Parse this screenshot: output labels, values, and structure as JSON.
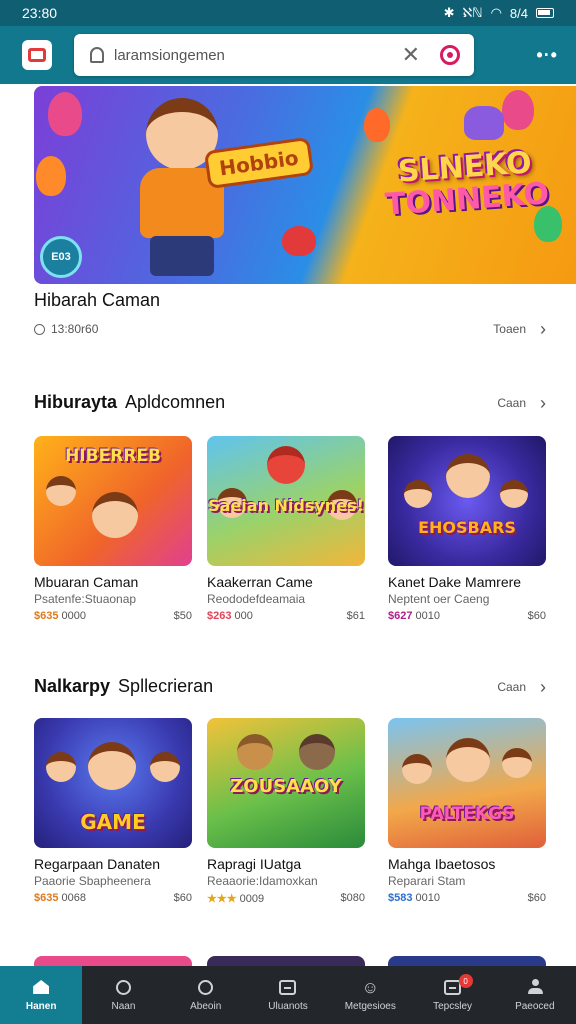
{
  "status_bar": {
    "time": "23:80",
    "icons": [
      "bluetooth-icon",
      "signal-icon",
      "wifi-icon",
      "battery-icon"
    ],
    "signal_text": "ℵℕ",
    "percent": "8/4"
  },
  "top_bar": {
    "search_text": "laramsiongemen",
    "colors": {
      "bar": "#11788d",
      "mic": "#d81b60"
    }
  },
  "hero": {
    "badge_text": "Hobbio",
    "title_line1": "SLNEKO",
    "title_line2": "TONNEKO",
    "chip_text": "E03"
  },
  "featured": {
    "title": "Hibarah Caman",
    "meta": "13:80r60",
    "more_label": "Toaen"
  },
  "section1": {
    "title_bold": "Hiburayta",
    "title_rest": "Apldcomnen",
    "more_label": "Caan",
    "cards": [
      {
        "thumb_text": "HIBERREB",
        "title": "Mbuaran Caman",
        "sub": "Psatenfe:Stuaonap",
        "price": "$635",
        "count": "0000",
        "right": "$50",
        "price_color": "#e07b1c"
      },
      {
        "thumb_text": "Saeian Nidsynes!",
        "title": "Kaakerran Came",
        "sub": "Reododefdeamaia",
        "price": "$263",
        "count": "000",
        "right": "$61",
        "price_color": "#e0445a"
      },
      {
        "thumb_text": "EHOSBARS",
        "title": "Kanet Dake Mamrere",
        "sub": "Neptent oer Caeng",
        "price": "$627",
        "count": "0010",
        "right": "$60",
        "price_color": "#b0208a"
      }
    ]
  },
  "section2": {
    "title_bold": "Nalkarpy",
    "title_rest": "Spllecrieran",
    "more_label": "Caan",
    "cards": [
      {
        "thumb_text": "GAME",
        "title": "Regarpaan Danaten",
        "sub": "Paaorie Sbapheenera",
        "price": "$635",
        "count": "0068",
        "right": "$60",
        "price_color": "#e07b1c"
      },
      {
        "thumb_text": "ZOUSAAOY",
        "title": "Rapragi IUatga",
        "sub": "Reaaorie:Idamoxkan",
        "price": "★★★",
        "count": "0009",
        "right": "$080",
        "price_color": "#e0a81c"
      },
      {
        "thumb_text": "PALTEKGS",
        "title": "Mahga Ibaetosos",
        "sub": "Reparari Stam",
        "price": "$583",
        "count": "0010",
        "right": "$60",
        "price_color": "#2a6fd0"
      }
    ]
  },
  "bottom_nav": {
    "items": [
      {
        "label": "Hanen",
        "icon": "home-icon"
      },
      {
        "label": "Naan",
        "icon": "search-icon"
      },
      {
        "label": "Abeoin",
        "icon": "search-icon"
      },
      {
        "label": "Uluanots",
        "icon": "apps-icon"
      },
      {
        "label": "Metgesioes",
        "icon": "chat-icon"
      },
      {
        "label": "Tepcsley",
        "icon": "notification-icon",
        "badge": "0"
      },
      {
        "label": "Paeoced",
        "icon": "profile-icon"
      }
    ]
  }
}
